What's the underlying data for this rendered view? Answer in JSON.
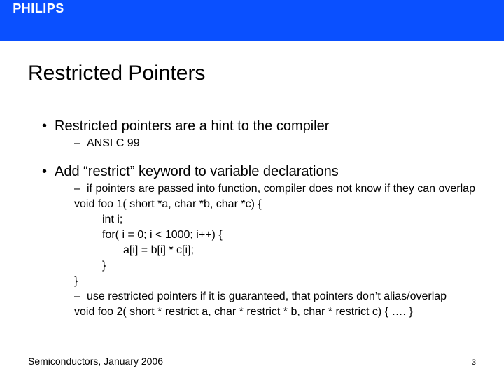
{
  "brand": "PHILIPS",
  "title": "Restricted Pointers",
  "bullets": {
    "p1": "Restricted pointers are a hint to the compiler",
    "p1_sub1": "ANSI C 99",
    "p2": "Add “restrict” keyword to variable declarations",
    "p2_sub1": "if pointers are passed into function, compiler does not know if they can overlap",
    "p2_code": {
      "l1": "void foo 1( short *a, char *b, char *c) {",
      "l2": "int i;",
      "l3": "for( i = 0; i < 1000; i++) {",
      "l4": "a[i] = b[i] * c[i];",
      "l5": "}",
      "l6": "}"
    },
    "p2_sub2": "use restricted pointers if it is guaranteed, that pointers don’t alias/overlap",
    "p2_code2": "void foo 2( short * restrict a, char * restrict * b, char * restrict c) { …. }"
  },
  "footer": "Semiconductors, January 2006",
  "page": "3"
}
